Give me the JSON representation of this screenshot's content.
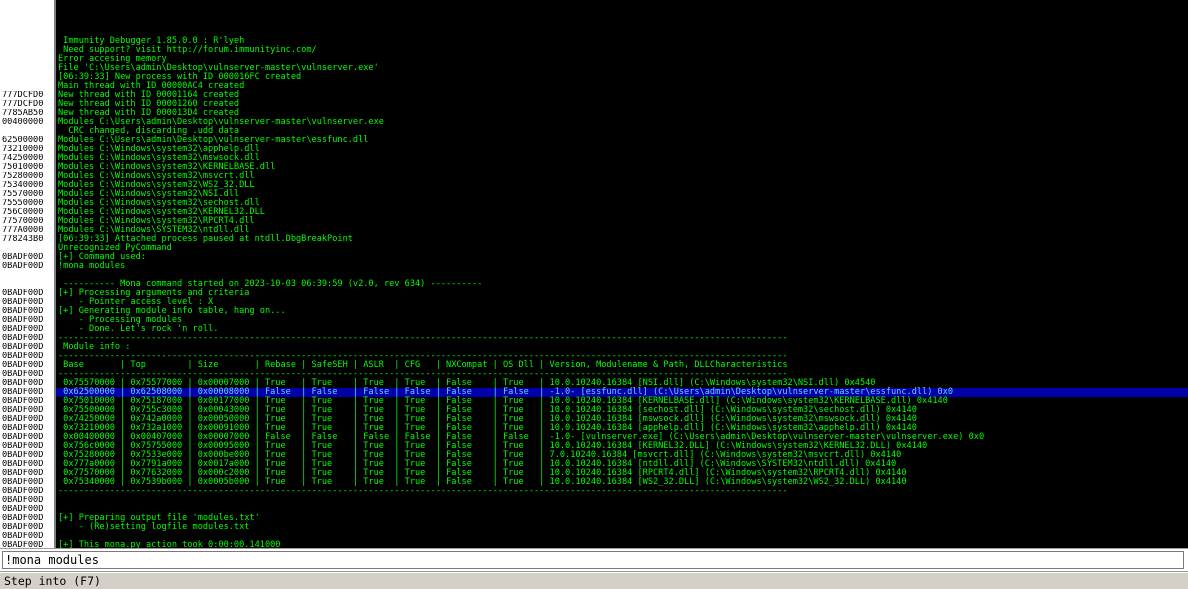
{
  "log_lines": [
    {
      "addr": "",
      "msg": ""
    },
    {
      "addr": "",
      "msg": ""
    },
    {
      "addr": "",
      "msg": ""
    },
    {
      "addr": "",
      "msg": ""
    },
    {
      "addr": "",
      "msg": " Immunity Debugger 1.85.0.0 : R'lyeh"
    },
    {
      "addr": "",
      "msg": " Need support? visit http://forum.immunityinc.com/"
    },
    {
      "addr": "",
      "msg": "Error accesing memory"
    },
    {
      "addr": "",
      "msg": "File 'C:\\Users\\admin\\Desktop\\vulnserver-master\\vulnserver.exe'"
    },
    {
      "addr": "",
      "msg": "[06:39:33] New process with ID 000016FC created"
    },
    {
      "addr": "",
      "msg": "Main thread with ID 00000AC4 created"
    },
    {
      "addr": "777DCFD0",
      "msg": "New thread with ID 00001164 created"
    },
    {
      "addr": "777DCFD0",
      "msg": "New thread with ID 00001260 created"
    },
    {
      "addr": "7785AB50",
      "msg": "New thread with ID 000013D4 created"
    },
    {
      "addr": "00400000",
      "msg": "Modules C:\\Users\\admin\\Desktop\\vulnserver-master\\vulnserver.exe"
    },
    {
      "addr": "",
      "msg": "  CRC changed, discarding .udd data"
    },
    {
      "addr": "62500000",
      "msg": "Modules C:\\Users\\admin\\Desktop\\vulnserver-master\\essfunc.dll"
    },
    {
      "addr": "73210000",
      "msg": "Modules C:\\Windows\\system32\\apphelp.dll"
    },
    {
      "addr": "74250000",
      "msg": "Modules C:\\Windows\\system32\\mswsock.dll"
    },
    {
      "addr": "75010000",
      "msg": "Modules C:\\Windows\\system32\\KERNELBASE.dll"
    },
    {
      "addr": "75280000",
      "msg": "Modules C:\\Windows\\system32\\msvcrt.dll"
    },
    {
      "addr": "75340000",
      "msg": "Modules C:\\Windows\\system32\\WS2_32.DLL"
    },
    {
      "addr": "75570000",
      "msg": "Modules C:\\Windows\\system32\\NSI.dll"
    },
    {
      "addr": "75550000",
      "msg": "Modules C:\\Windows\\system32\\sechost.dll"
    },
    {
      "addr": "756C0000",
      "msg": "Modules C:\\Windows\\system32\\KERNEL32.DLL"
    },
    {
      "addr": "77570000",
      "msg": "Modules C:\\Windows\\system32\\RPCRT4.dll"
    },
    {
      "addr": "777A0000",
      "msg": "Modules C:\\Windows\\SYSTEM32\\ntdll.dll"
    },
    {
      "addr": "778243B0",
      "msg": "[06:39:33] Attached process paused at ntdll.DbgBreakPoint"
    },
    {
      "addr": "",
      "msg": "Unrecognized PyCommand"
    },
    {
      "addr": "0BADF00D",
      "msg": "[+] Command used:"
    },
    {
      "addr": "0BADF00D",
      "msg": "!mona modules"
    },
    {
      "addr": "",
      "msg": ""
    },
    {
      "addr": "",
      "msg": " ---------- Mona command started on 2023-10-03 06:39:59 (v2.0, rev 634) ----------"
    },
    {
      "addr": "0BADF00D",
      "msg": "[+] Processing arguments and criteria"
    },
    {
      "addr": "0BADF00D",
      "msg": "    - Pointer access level : X"
    },
    {
      "addr": "0BADF00D",
      "msg": "[+] Generating module info table, hang on..."
    },
    {
      "addr": "0BADF00D",
      "msg": "    - Processing modules"
    },
    {
      "addr": "0BADF00D",
      "msg": "    - Done. Let's rock 'n roll."
    },
    {
      "addr": "0BADF00D",
      "msg": "---------------------------------------------------------------------------------------------------------------------------------------------"
    },
    {
      "addr": "0BADF00D",
      "msg": " Module info :"
    },
    {
      "addr": "0BADF00D",
      "msg": "---------------------------------------------------------------------------------------------------------------------------------------------"
    },
    {
      "addr": "0BADF00D",
      "msg": " Base       | Top        | Size       | Rebase | SafeSEH | ASLR  | CFG   | NXCompat | OS Dll | Version, Modulename & Path, DLLCharacteristics"
    },
    {
      "addr": "0BADF00D",
      "msg": "---------------------------------------------------------------------------------------------------------------------------------------------"
    },
    {
      "addr": "0BADF00D",
      "msg": " 0x75570000 | 0x75577000 | 0x00007000 | True   | True    | True  | True  | False    | True   | 10.0.10240.16384 [NSI.dll] (C:\\Windows\\system32\\NSI.dll) 0x4540"
    },
    {
      "addr": "0BADF00D",
      "msg": " 0x62500000 | 0x62508000 | 0x00008000 | False  | False   | False | False | False    | False  | -1.0- [essfunc.dll] (C:\\Users\\admin\\Desktop\\vulnserver-master\\essfunc.dll) 0x0",
      "hl": true
    },
    {
      "addr": "0BADF00D",
      "msg": " 0x75010000 | 0x75187000 | 0x00177000 | True   | True    | True  | True  | False    | True   | 10.0.10240.16384 [KERNELBASE.dll] (C:\\Windows\\system32\\KERNELBASE.dll) 0x4140"
    },
    {
      "addr": "0BADF00D",
      "msg": " 0x75500000 | 0x755c3000 | 0x00043000 | True   | True    | True  | True  | False    | True   | 10.0.10240.16384 [sechost.dll] (C:\\Windows\\system32\\sechost.dll) 0x4140"
    },
    {
      "addr": "0BADF00D",
      "msg": " 0x74250000 | 0x742a0000 | 0x00050000 | True   | True    | True  | True  | False    | True   | 10.0.10240.16384 [mswsock.dll] (C:\\Windows\\system32\\mswsock.dll) 0x4140"
    },
    {
      "addr": "0BADF00D",
      "msg": " 0x73210000 | 0x732a1000 | 0x00091000 | True   | True    | True  | True  | False    | True   | 10.0.10240.16384 [apphelp.dll] (C:\\Windows\\system32\\apphelp.dll) 0x4140"
    },
    {
      "addr": "0BADF00D",
      "msg": " 0x00400000 | 0x00407000 | 0x00007000 | False  | False   | False | False | False    | False  | -1.0- [vulnserver.exe] (C:\\Users\\admin\\Desktop\\vulnserver-master\\vulnserver.exe) 0x0"
    },
    {
      "addr": "0BADF00D",
      "msg": " 0x756c0000 | 0x75755000 | 0x00095000 | True   | True    | True  | True  | False    | True   | 10.0.10240.16384 [KERNEL32.DLL] (C:\\Windows\\system32\\KERNEL32.DLL) 0x4140"
    },
    {
      "addr": "0BADF00D",
      "msg": " 0x75280000 | 0x7533e000 | 0x000be000 | True   | True    | True  | True  | False    | True   | 7.0.10240.16384 [msvcrt.dll] (C:\\Windows\\system32\\msvcrt.dll) 0x4140"
    },
    {
      "addr": "0BADF00D",
      "msg": " 0x777a0000 | 0x7791a000 | 0x0017a000 | True   | True    | True  | True  | False    | True   | 10.0.10240.16384 [ntdll.dll] (C:\\Windows\\SYSTEM32\\ntdll.dll) 0x4140"
    },
    {
      "addr": "0BADF00D",
      "msg": " 0x77570000 | 0x77632000 | 0x000c2000 | True   | True    | True  | True  | False    | True   | 10.0.10240.16384 [RPCRT4.dll] (C:\\Windows\\system32\\RPCRT4.dll) 0x4140"
    },
    {
      "addr": "0BADF00D",
      "msg": " 0x75340000 | 0x7539b000 | 0x0005b000 | True   | True    | True  | True  | False    | True   | 10.0.10240.16384 [WS2_32.DLL] (C:\\Windows\\system32\\WS2_32.DLL) 0x4140"
    },
    {
      "addr": "0BADF00D",
      "msg": "---------------------------------------------------------------------------------------------------------------------------------------------"
    },
    {
      "addr": "0BADF00D",
      "msg": ""
    },
    {
      "addr": "0BADF00D",
      "msg": ""
    },
    {
      "addr": "0BADF00D",
      "msg": "[+] Preparing output file 'modules.txt'"
    },
    {
      "addr": "0BADF00D",
      "msg": "    - (Re)setting logfile modules.txt"
    },
    {
      "addr": "0BADF00D",
      "msg": ""
    },
    {
      "addr": "0BADF00D",
      "msg": "[+] This mona.py action took 0:00:00.141000"
    }
  ],
  "command_bar": {
    "value": "!mona modules"
  },
  "status_bar": {
    "text": "Step into (F7)"
  },
  "colors": {
    "log_text": "#00ff00",
    "highlight": "#0000aa",
    "background": "#000000"
  }
}
